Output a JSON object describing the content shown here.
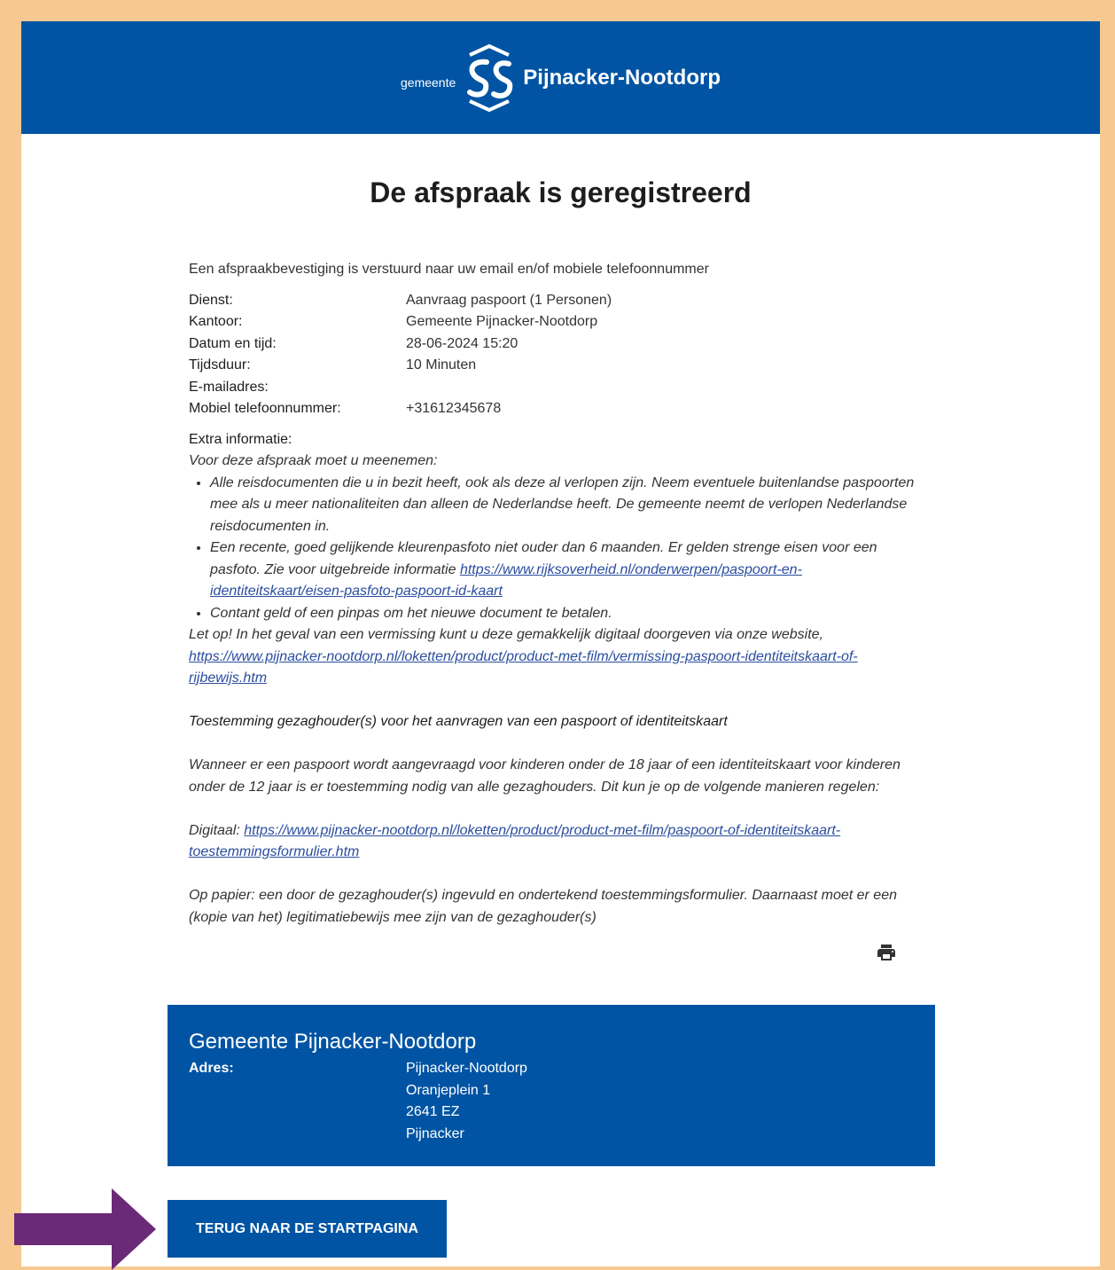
{
  "header": {
    "logo_small": "gemeente",
    "logo_name": "Pijnacker-Nootdorp"
  },
  "page_title": "De afspraak is geregistreerd",
  "intro": "Een afspraakbevestiging is verstuurd naar uw email en/of mobiele telefoonnummer",
  "details": [
    {
      "label": "Dienst:",
      "value": "Aanvraag paspoort (1 Personen)"
    },
    {
      "label": "Kantoor:",
      "value": "Gemeente Pijnacker-Nootdorp"
    },
    {
      "label": "Datum en tijd:",
      "value": "28-06-2024 15:20"
    },
    {
      "label": "Tijdsduur:",
      "value": "10 Minuten"
    },
    {
      "label": "E-mailadres:",
      "value": ""
    },
    {
      "label": "Mobiel telefoonnummer:",
      "value": "+31612345678"
    }
  ],
  "extra": {
    "label": "Extra informatie:",
    "heading": "Voor deze afspraak moet u meenemen:",
    "bullet1": "Alle reisdocumenten die u in bezit heeft, ook als deze al verlopen zijn. Neem eventuele buitenlandse paspoorten mee als u meer nationaliteiten dan alleen de Nederlandse heeft. De gemeente neemt de verlopen Nederlandse reisdocumenten in.",
    "bullet2_text": "Een recente, goed gelijkende kleurenpasfoto niet ouder dan 6 maanden. Er gelden strenge eisen voor een pasfoto. Zie voor uitgebreide informatie ",
    "bullet2_link": "https://www.rijksoverheid.nl/onderwerpen/paspoort-en-identiteitskaart/eisen-pasfoto-paspoort-id-kaart",
    "bullet3": "Contant geld of een pinpas om het nieuwe document te betalen.",
    "note_text": "Let op! In het geval van een vermissing kunt u deze gemakkelijk digitaal doorgeven via onze website, ",
    "note_link": "https://www.pijnacker-nootdorp.nl/loketten/product/product-met-film/vermissing-paspoort-identiteitskaart-of-rijbewijs.htm",
    "consent_heading": "Toestemming gezaghouder(s) voor het aanvragen van een paspoort of identiteitskaart",
    "consent_text": "Wanneer er een paspoort wordt aangevraagd voor kinderen onder de 18 jaar of een identiteitskaart voor kinderen onder de 12 jaar is er toestemming nodig van alle gezaghouders. Dit kun je op de volgende manieren regelen:",
    "digital_prefix": "Digitaal: ",
    "digital_link": "https://www.pijnacker-nootdorp.nl/loketten/product/product-met-film/paspoort-of-identiteitskaart-toestemmingsformulier.htm",
    "paper_text": "Op papier: een door de gezaghouder(s) ingevuld en ondertekend toestemmingsformulier. Daarnaast moet er een (kopie van het) legitimatiebewijs mee zijn van de gezaghouder(s)"
  },
  "print_icon": "printer-icon",
  "office": {
    "name": "Gemeente Pijnacker-Nootdorp",
    "address_label": "Adres:",
    "lines": [
      "Pijnacker-Nootdorp",
      "Oranjeplein 1",
      "2641 EZ",
      "Pijnacker"
    ]
  },
  "back_button": "TERUG NAAR DE STARTPAGINA",
  "colors": {
    "brand_blue": "#0054a3",
    "frame": "#f5c991",
    "arrow": "#6b2a78",
    "link": "#2a4d9f"
  }
}
